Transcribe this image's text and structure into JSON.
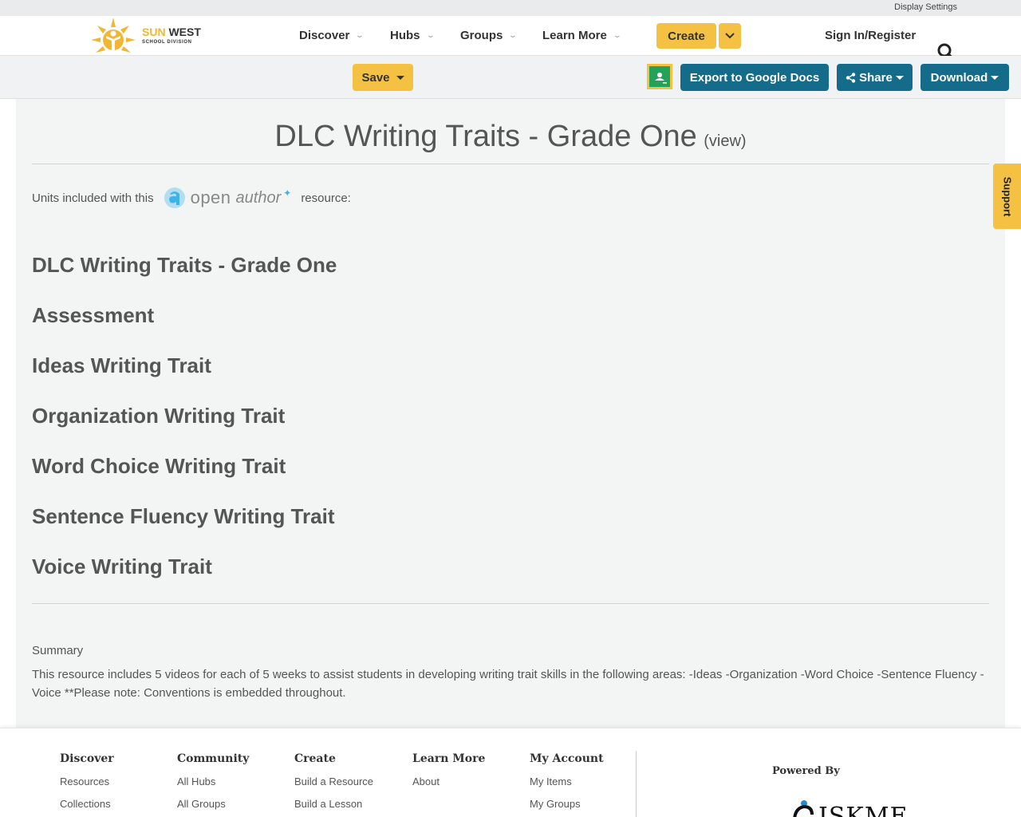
{
  "top_bar": {
    "display_settings": "Display Settings"
  },
  "logo": {
    "sun": "SUN",
    "west": " WEST",
    "sub": "SCHOOL DIVISION"
  },
  "nav": {
    "items": [
      {
        "label": "Discover"
      },
      {
        "label": "Hubs"
      },
      {
        "label": "Groups"
      },
      {
        "label": "Learn More"
      }
    ],
    "create": "Create",
    "sign_in": "Sign In/Register"
  },
  "toolbar": {
    "save": "Save",
    "export": "Export to Google Docs",
    "share": "Share",
    "download": "Download"
  },
  "resource": {
    "title": "DLC Writing Traits - Grade One",
    "view": "(view)",
    "units_prefix": "Units included with this",
    "open_text": "open",
    "author_text": "author",
    "units_suffix": "resource:",
    "units": [
      "DLC Writing Traits - Grade One",
      "Assessment",
      "Ideas Writing Trait",
      "Organization Writing Trait",
      "Word Choice Writing Trait",
      "Sentence Fluency Writing Trait",
      "Voice Writing Trait"
    ],
    "summary_label": "Summary",
    "summary_text": "This resource includes 5 videos for each of 5 weeks to assist students in developing writing trait skills in the following areas: -Ideas -Organization -Word Choice -Sentence Fluency -Voice **Please note: Conventions is embedded throughout."
  },
  "support": "Support",
  "footer": {
    "columns": [
      {
        "heading": "Discover",
        "links": [
          "Resources",
          "Collections"
        ]
      },
      {
        "heading": "Community",
        "links": [
          "All Hubs",
          "All Groups"
        ]
      },
      {
        "heading": "Create",
        "links": [
          "Build a Resource",
          "Build a Lesson"
        ]
      },
      {
        "heading": "Learn More",
        "links": [
          "About"
        ]
      },
      {
        "heading": "My Account",
        "links": [
          "My Items",
          "My Groups"
        ]
      }
    ],
    "powered_by": "Powered By",
    "iskme": "ISKME"
  },
  "colors": {
    "accent_yellow": "#f5c143",
    "button_blue": "#156b8a",
    "classroom_green": "#25a25a"
  }
}
